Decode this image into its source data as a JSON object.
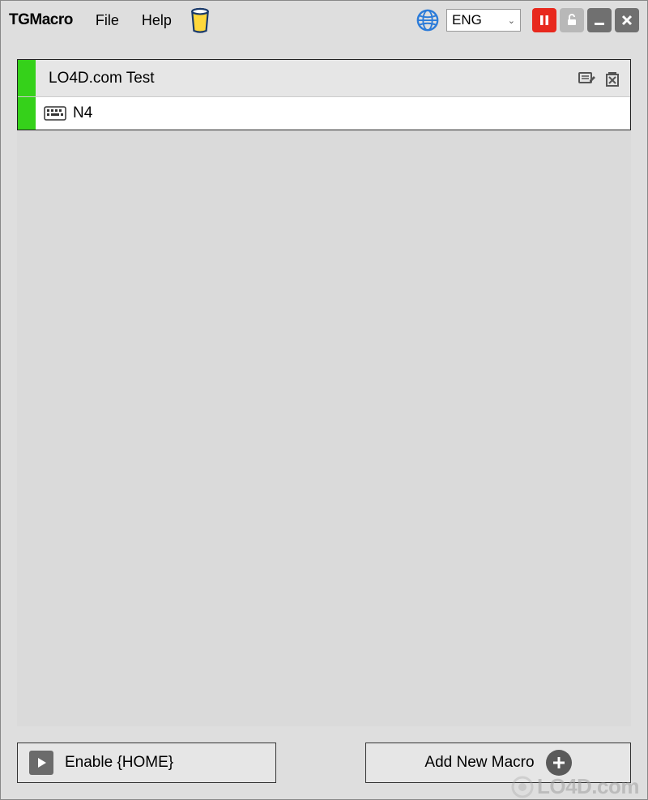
{
  "app": {
    "title": "TGMacro"
  },
  "menu": {
    "file": "File",
    "help": "Help"
  },
  "language": {
    "selected": "ENG"
  },
  "macro": {
    "title": "LO4D.com Test",
    "steps": [
      {
        "label": "N4"
      }
    ]
  },
  "footer": {
    "enable_label": "Enable {HOME}",
    "add_label": "Add New Macro"
  },
  "watermark": {
    "text": "LO4D.com"
  }
}
